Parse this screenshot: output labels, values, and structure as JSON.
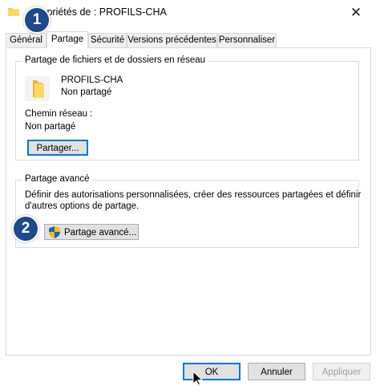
{
  "window": {
    "title": "Propriétés de : PROFILS-CHA"
  },
  "tabs": [
    {
      "label": "Général"
    },
    {
      "label": "Partage",
      "active": true
    },
    {
      "label": "Sécurité"
    },
    {
      "label": "Versions précédentes"
    },
    {
      "label": "Personnaliser"
    }
  ],
  "network_share": {
    "legend": "Partage de fichiers et de dossiers en réseau",
    "folder_name": "PROFILS-CHA",
    "share_status": "Non partagé",
    "network_path_label": "Chemin réseau :",
    "network_path_value": "Non partagé",
    "share_button": "Partager..."
  },
  "advanced_share": {
    "legend": "Partage avancé",
    "description_line1": "Définir des autorisations personnalisées, créer des ressources partagées et définir",
    "description_line2": "d'autres options de partage.",
    "button": "Partage avancé..."
  },
  "footer": {
    "ok": "OK",
    "cancel": "Annuler",
    "apply": "Appliquer"
  },
  "annotations": {
    "badge1": "1",
    "badge2": "2",
    "badge_color": "#1e4a8c"
  },
  "icons": [
    "folder-icon",
    "close-icon",
    "shield-icon",
    "cursor-icon"
  ]
}
